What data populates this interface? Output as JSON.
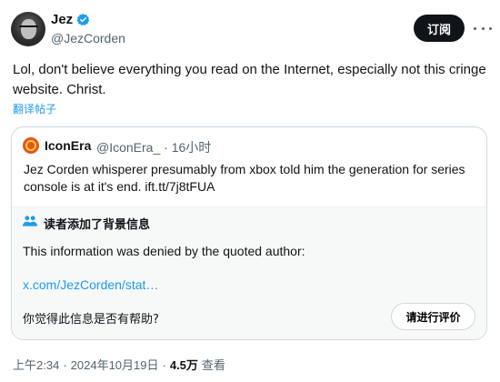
{
  "author": {
    "name": "Jez",
    "handle": "@JezCorden",
    "subscribe_label": "订阅"
  },
  "tweet": {
    "text": "Lol, don't believe everything you read on the Internet, especially not this cringe website. Christ.",
    "translate_label": "翻译帖子"
  },
  "quote": {
    "name": "IconEra",
    "handle": "@IconEra_ · 16小时",
    "text": "Jez Corden whisperer presumably from xbox told him the generation for series console is at it's end. ift.tt/7j8tFUA"
  },
  "community_note": {
    "title": "读者添加了背景信息",
    "body": "This information was denied by the quoted author:",
    "link": "x.com/JezCorden/stat…",
    "helpful_question": "你觉得此信息是否有帮助?",
    "rate_label": "请进行评价"
  },
  "meta": {
    "time": "上午2:34",
    "date": "2024年10月19日",
    "separator": "·",
    "views_count": "4.5万",
    "views_label": "查看"
  },
  "colors": {
    "accent": "#1d9bf0",
    "text_primary": "#0f1419",
    "text_secondary": "#536471",
    "border": "#cfd9de",
    "note_bg": "#f7f9f9"
  }
}
